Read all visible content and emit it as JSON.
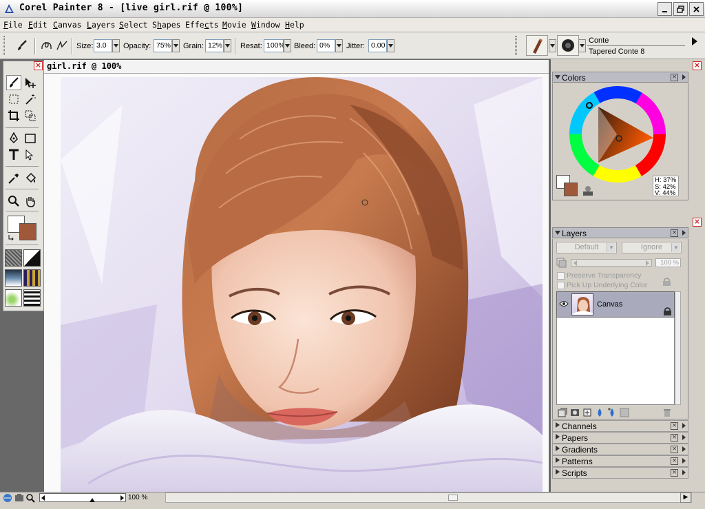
{
  "app": {
    "title": "Corel Painter 8 - [live girl.rif @ 100%]"
  },
  "menu": [
    {
      "label": "File",
      "accel": "F",
      "rest": "ile"
    },
    {
      "label": "Edit",
      "accel": "E",
      "rest": "dit"
    },
    {
      "label": "Canvas",
      "accel": "C",
      "rest": "anvas"
    },
    {
      "label": "Layers",
      "accel": "L",
      "rest": "ayers"
    },
    {
      "label": "Select",
      "accel": "S",
      "rest": "elect"
    },
    {
      "label": "Shapes",
      "accel": "h",
      "pre": "S",
      "rest": "apes"
    },
    {
      "label": "Effects",
      "accel": "c",
      "pre": "Effe",
      "rest": "ts"
    },
    {
      "label": "Movie",
      "accel": "M",
      "rest": "ovie"
    },
    {
      "label": "Window",
      "accel": "W",
      "rest": "indow"
    },
    {
      "label": "Help",
      "accel": "H",
      "rest": "elp"
    }
  ],
  "properties": {
    "size_label": "Size:",
    "size_value": "3.0",
    "opacity_label": "Opacity:",
    "opacity_value": "75%",
    "grain_label": "Grain:",
    "grain_value": "12%",
    "resat_label": "Resat:",
    "resat_value": "100%",
    "bleed_label": "Bleed:",
    "bleed_value": "0%",
    "jitter_label": "Jitter:",
    "jitter_value": "0.00"
  },
  "brush": {
    "category": "Conte",
    "variant": "Tapered Conte 8"
  },
  "document": {
    "title": "girl.rif @ 100%"
  },
  "colors_panel": {
    "title": "Colors",
    "h": "H: 37%",
    "s": "S: 42%",
    "v": "V: 44%",
    "main_color": "#a0583a",
    "additional_color": "#ffffff"
  },
  "layers_panel": {
    "title": "Layers",
    "composite_method": "Default",
    "composite_depth": "Ignore",
    "opacity": "100 %",
    "preserve_transparency": "Preserve Transparency",
    "pick_up_underlying": "Pick Up Underlying Color",
    "layers": [
      {
        "name": "Canvas",
        "visible": true,
        "locked": true,
        "selected": true
      }
    ]
  },
  "collapsed_panels": [
    {
      "title": "Channels"
    },
    {
      "title": "Papers"
    },
    {
      "title": "Gradients"
    },
    {
      "title": "Patterns"
    },
    {
      "title": "Scripts"
    }
  ],
  "status": {
    "zoom": "100 %"
  },
  "icons": [
    "brush-icon",
    "layer-adjuster-icon",
    "rectangular-selection-icon",
    "magic-wand-icon",
    "crop-icon",
    "lasso-icon",
    "pen-icon",
    "rectangle-shape-icon",
    "text-icon",
    "shape-selection-icon",
    "dropper-icon",
    "paint-bucket-icon",
    "magnifier-icon",
    "grabber-icon"
  ]
}
